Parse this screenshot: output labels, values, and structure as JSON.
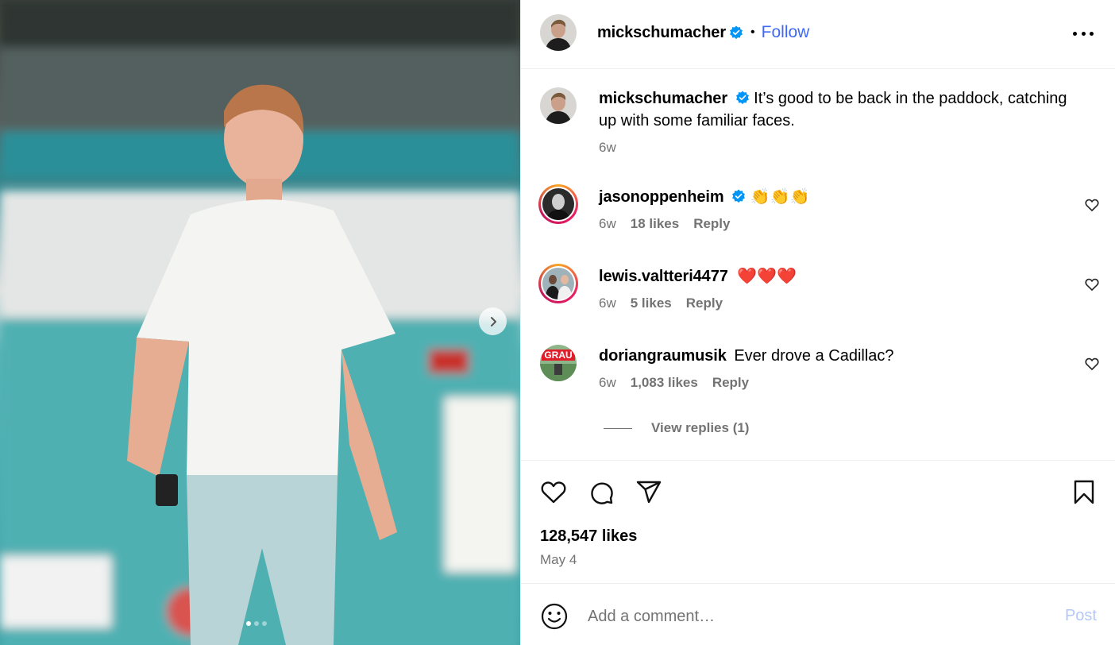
{
  "post": {
    "author": "mickschumacher",
    "follow_label": "Follow",
    "separator": "•",
    "caption": "It’s good to be back in the paddock, catching up with some familiar faces.",
    "caption_time": "6w",
    "likes": "128,547 likes",
    "date": "May 4",
    "carousel_index": 1,
    "carousel_count": 3
  },
  "comments": [
    {
      "user": "jasonoppenheim",
      "verified": true,
      "text": "👏👏👏",
      "time": "6w",
      "likes": "18 likes",
      "reply": "Reply"
    },
    {
      "user": "lewis.valtteri4477",
      "verified": false,
      "text": "❤️❤️❤️",
      "time": "6w",
      "likes": "5 likes",
      "reply": "Reply"
    },
    {
      "user": "doriangraumusik",
      "verified": false,
      "text": "Ever drove a Cadillac?",
      "time": "6w",
      "likes": "1,083 likes",
      "reply": "Reply",
      "view_replies": "View replies (1)"
    }
  ],
  "composer": {
    "placeholder": "Add a comment…",
    "post_label": "Post"
  },
  "colors": {
    "link_blue": "#3f68f4",
    "verified_blue": "#0095f6",
    "muted": "#737373",
    "post_disabled": "#b3c7f9"
  },
  "icons": [
    "more-icon",
    "verified-icon",
    "heart-icon",
    "comment-icon",
    "share-icon",
    "bookmark-icon",
    "emoji-icon",
    "chevron-right-icon"
  ]
}
